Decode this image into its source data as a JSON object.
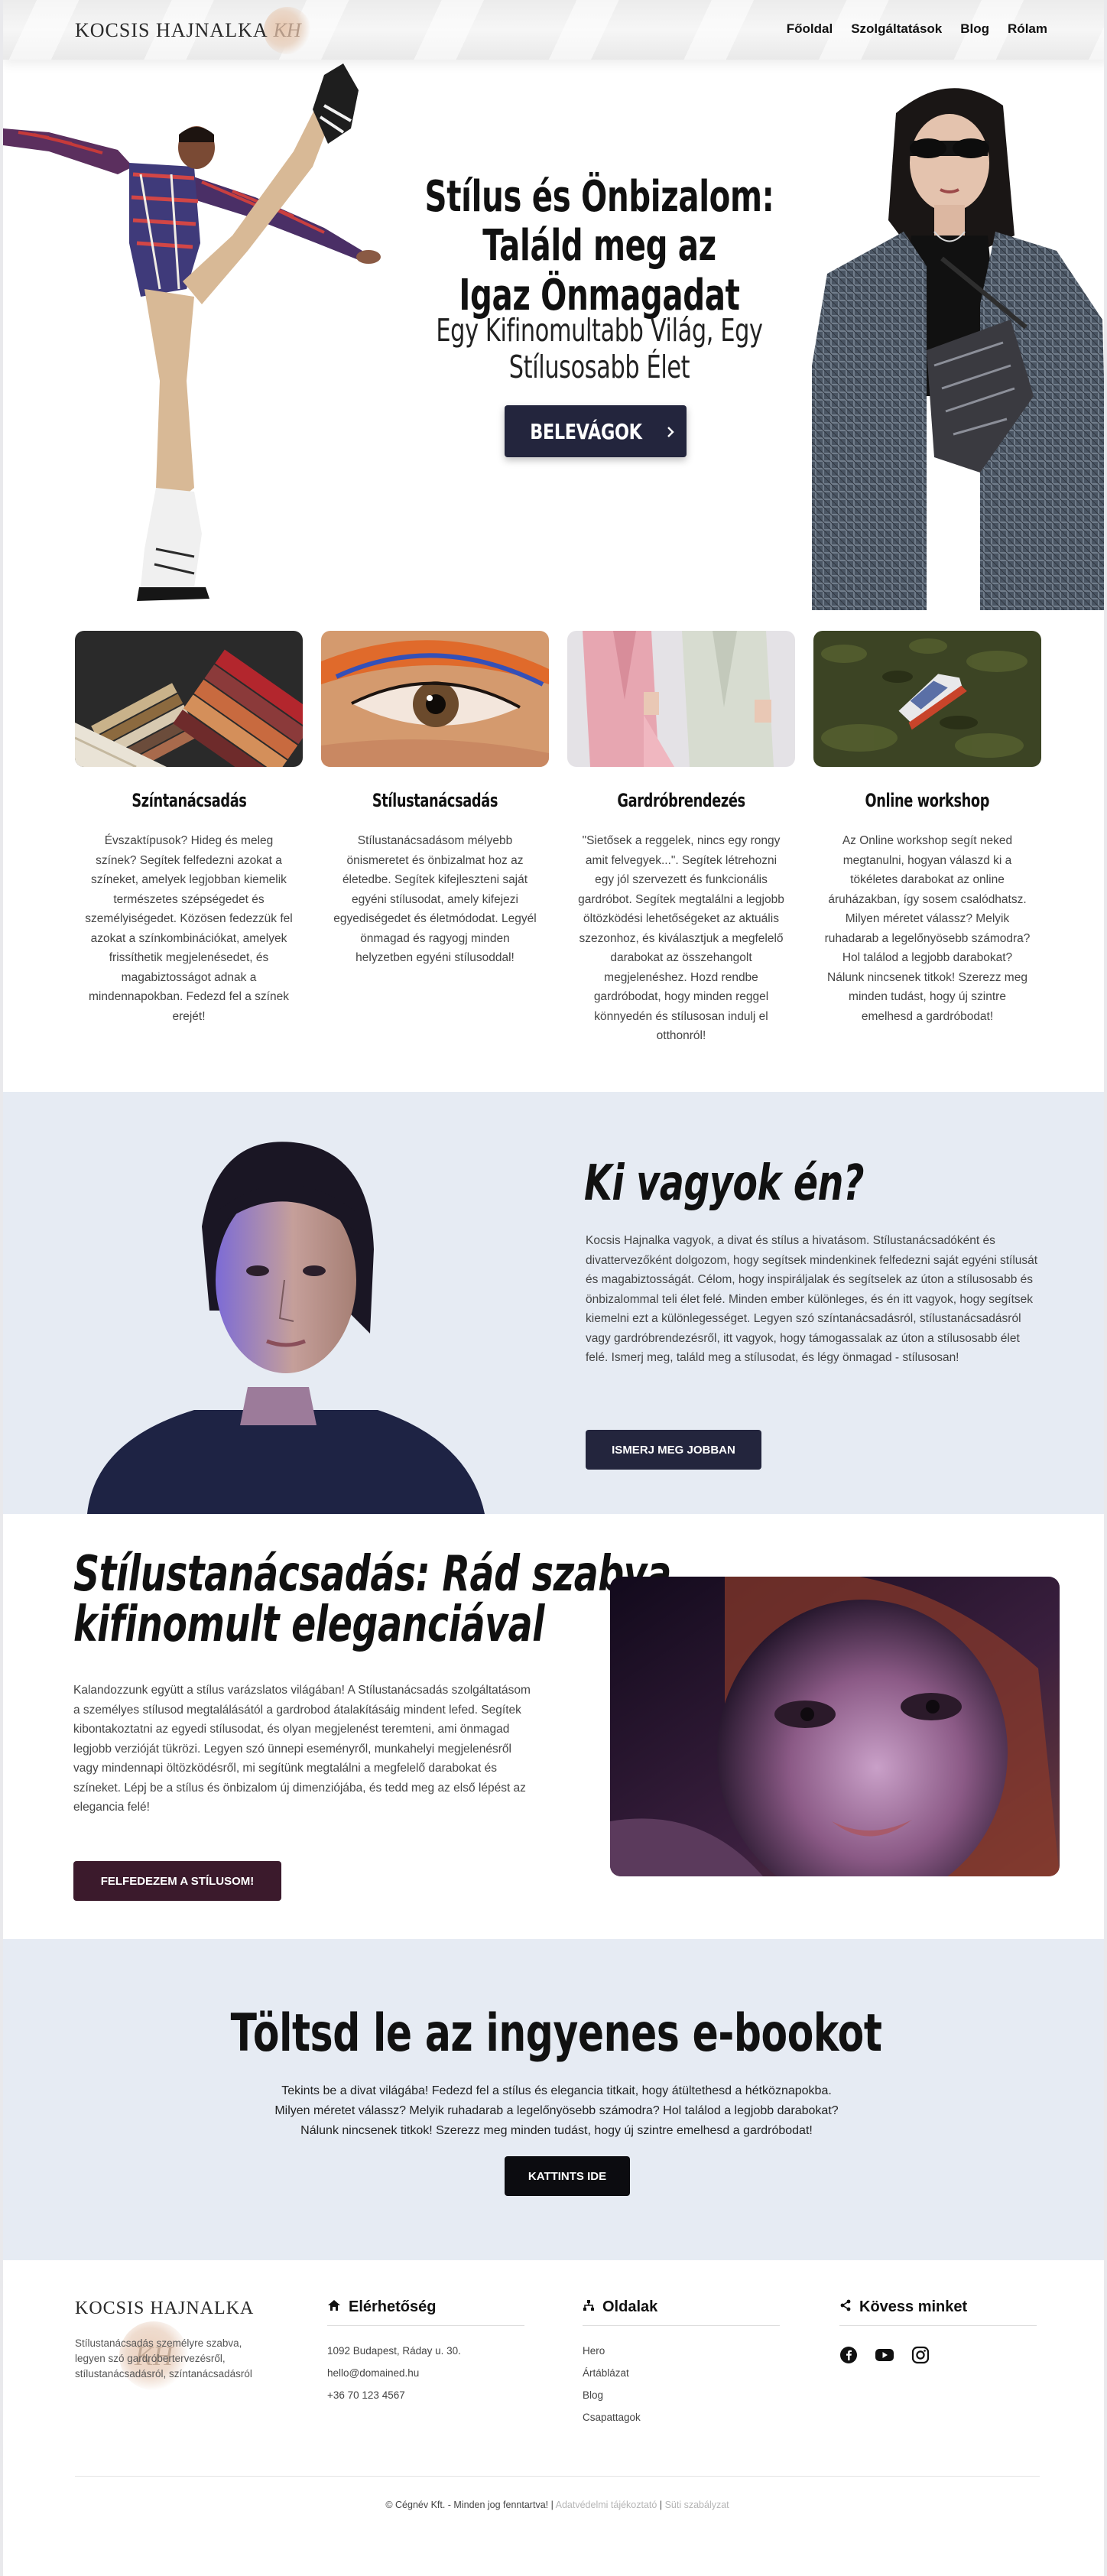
{
  "header": {
    "logo_text": "KOCSIS HAJNALKA",
    "logo_mark": "KH",
    "nav": [
      "Főoldal",
      "Szolgáltatások",
      "Blog",
      "Rólam"
    ]
  },
  "hero": {
    "title_line1": "Stílus és Önbizalom: Találd meg az",
    "title_line2": "Igaz Önmagadat",
    "subtitle": "Egy Kifinomultabb Világ, Egy Stílusosabb Élet",
    "button": "BELEVÁGOK",
    "button_icon": "chevron-right-icon"
  },
  "cards": [
    {
      "title": "Színtanácsadás",
      "text": "Évszaktípusok? Hideg és meleg színek? Segítek felfedezni azokat a színeket, amelyek legjobban kiemelik természetes szépségedet és személyiségedet. Közösen fedezzük fel azokat a színkombinációkat, amelyek frissíthetik megjelenésedet, és magabiztosságot adnak a mindennapokban. Fedezd fel a színek erejét!"
    },
    {
      "title": "Stílustanácsadás",
      "text": "Stílustanácsadásom mélyebb önismeretet és önbizalmat hoz az életedbe. Segítek kifejleszteni saját egyéni stílusodat, amely kifejezi egyediségedet és életmódodat. Legyél önmagad és ragyogj minden helyzetben egyéni stílusoddal!"
    },
    {
      "title": "Gardróbrendezés",
      "text": "\"Sietősek a reggelek, nincs egy rongy amit felvegyek...\". Segítek létrehozni egy jól szervezett és funkcionális gardróbot. Segítek megtalálni a legjobb öltözködési lehetőségeket az aktuális szezonhoz, és kiválasztjuk a megfelelő darabokat az összehangolt megjelenéshez. Hozd rendbe gardróbodat, hogy minden reggel könnyedén és stílusosan indulj el otthonról!"
    },
    {
      "title": "Online workshop",
      "text": "Az Online  workshop segít neked megtanulni, hogyan válaszd ki a tökéletes darabokat az online áruházakban, így sosem csalódhatsz. Milyen méretet válassz? Melyik ruhadarab a legelőnyösebb számodra? Hol találod a legjobb darabokat? Nálunk nincsenek titkok! Szerezz meg minden tudást, hogy új szintre emelhesd a gardróbodat!"
    }
  ],
  "about": {
    "title": "Ki vagyok én?",
    "text": "Kocsis Hajnalka vagyok, a divat és stílus a hivatásom. Stílustanácsadóként és divattervezőként dolgozom, hogy segítsek mindenkinek felfedezni saját egyéni stílusát és magabiztosságát. Célom, hogy inspiráljalak és segítselek az úton a stílusosabb és önbizalommal teli élet felé. Minden ember különleges, és én itt vagyok, hogy segítsek kiemelni ezt a különlegességet. Legyen szó színtanácsadásról, stílustanácsadásról vagy gardróbrendezésről, itt vagyok, hogy támogassalak az úton a stílusosabb élet felé. Ismerj meg, találd meg a stílusodat, és légy önmagad - stílusosan!",
    "button": "ISMERJ MEG JOBBAN"
  },
  "style_section": {
    "title_line1": "Stílustanácsadás: Rád szabva,",
    "title_line2": "kifinomult eleganciával",
    "text": "Kalandozzunk együtt a stílus varázslatos világában! A Stílustanácsadás szolgáltatásom a személyes stílusod megtalálásától a gardrobod átalakításáig mindent lefed. Segítek kibontakoztatni az egyedi stílusodat, és olyan megjelenést teremteni, ami önmagad legjobb verzióját tükrözi. Legyen szó ünnepi eseményről, munkahelyi megjelenésről vagy mindennapi öltözködésről, mi segítünk megtalálni a megfelelő darabokat és színeket. Lépj be a stílus és önbizalom új dimenziójába, és tedd meg az első lépést az elegancia felé!",
    "button": "FELFEDEZEM A STÍLUSOM!"
  },
  "ebook": {
    "title": "Töltsd le az ingyenes e-bookot",
    "line1": "Tekints be a divat világába! Fedezd fel a stílus és elegancia titkait, hogy átültethesd a hétköznapokba.",
    "line2": "Milyen méretet válassz? Melyik ruhadarab a legelőnyösebb számodra? Hol találod a legjobb darabokat?",
    "line3": "Nálunk nincsenek titkok! Szerezz meg minden tudást, hogy új szintre emelhesd a gardróbodat!",
    "button": "KATTINTS IDE"
  },
  "footer": {
    "logo_text": "KOCSIS HAJNALKA",
    "logo_mark": "KH",
    "description": "Stílustanácsadás személyre szabva, legyen szó gardróbertervezésről, stílustanácsadásról, színtanácsadásról",
    "contact_heading": "Elérhetőség",
    "contact_icon": "home-icon",
    "contact": [
      "1092 Budapest, Ráday u. 30.",
      "hello@domained.hu",
      "+36 70 123 4567"
    ],
    "pages_heading": "Oldalak",
    "pages_icon": "sitemap-icon",
    "pages": [
      "Hero",
      "Ártáblázat",
      "Blog",
      "Csapattagok"
    ],
    "social_heading": "Kövess minket",
    "social_icon": "share-icon",
    "social": [
      "facebook-icon",
      "youtube-icon",
      "instagram-icon"
    ],
    "copyright": "© Cégnév Kft. - Minden jog fenntartva! |",
    "privacy": "Adatvédelmi tájékoztató",
    "separator": "|",
    "terms": "Süti szabályzat"
  }
}
